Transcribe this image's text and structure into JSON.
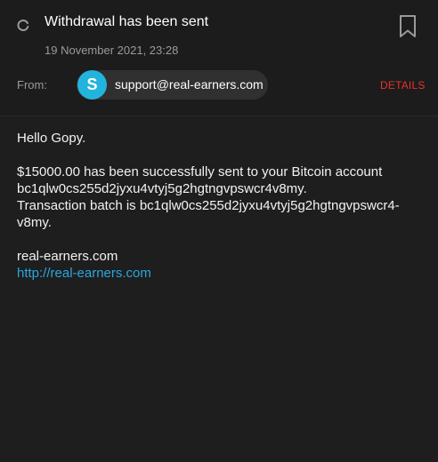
{
  "email": {
    "subject": "Withdrawal has been sent",
    "date": "19 November 2021, 23:28",
    "from_label": "From:",
    "sender_initial": "S",
    "sender_email": "support@real-earners.com",
    "details_label": "DETAILS"
  },
  "body": {
    "greeting": "Hello Gopy.",
    "lines": [
      "$15000.00 has been successfully sent to your Bitcoin account",
      "bc1qlw0cs255d2jyxu4vtyj5g2hgtngvpswcr4v8my.",
      "Transaction batch is bc1qlw0cs255d2jyxu4vtyj5g2hgtngvpswcr4-",
      "v8my."
    ],
    "signature_site": "real-earners.com",
    "signature_link": "http://real-earners.com"
  },
  "icons": {
    "refresh": "refresh-icon",
    "bookmark": "bookmark-icon"
  },
  "colors": {
    "background": "#1e1e1e",
    "avatar": "#23b4de",
    "details": "#e8322d",
    "link": "#2aa7de"
  }
}
